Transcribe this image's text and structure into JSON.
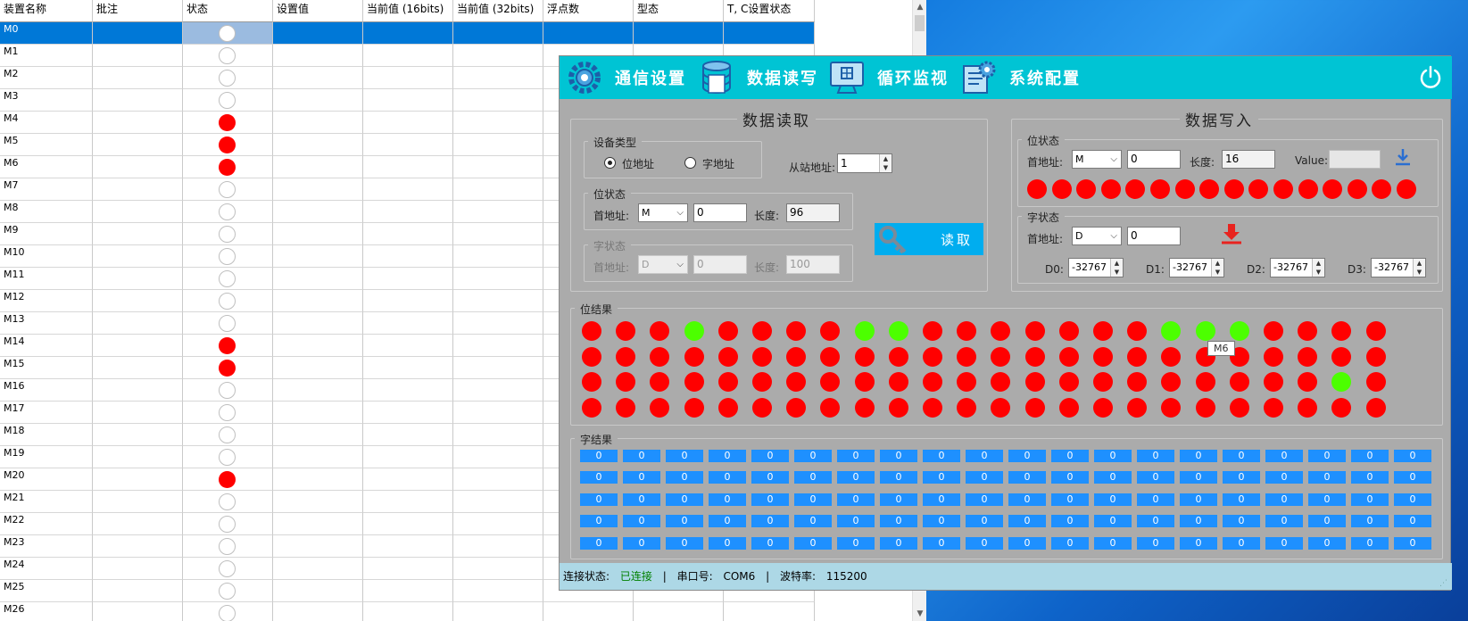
{
  "grid": {
    "headers": [
      "装置名称",
      "批注",
      "状态",
      "设置值",
      "当前值 (16bits)",
      "当前值 (32bits)",
      "浮点数",
      "型态",
      "T, C设置状态"
    ],
    "rows": [
      {
        "name": "M0",
        "on": false,
        "selected": true
      },
      {
        "name": "M1",
        "on": false
      },
      {
        "name": "M2",
        "on": false
      },
      {
        "name": "M3",
        "on": false
      },
      {
        "name": "M4",
        "on": true
      },
      {
        "name": "M5",
        "on": true
      },
      {
        "name": "M6",
        "on": true
      },
      {
        "name": "M7",
        "on": false
      },
      {
        "name": "M8",
        "on": false
      },
      {
        "name": "M9",
        "on": false
      },
      {
        "name": "M10",
        "on": false
      },
      {
        "name": "M11",
        "on": false
      },
      {
        "name": "M12",
        "on": false
      },
      {
        "name": "M13",
        "on": false
      },
      {
        "name": "M14",
        "on": true
      },
      {
        "name": "M15",
        "on": true
      },
      {
        "name": "M16",
        "on": false
      },
      {
        "name": "M17",
        "on": false
      },
      {
        "name": "M18",
        "on": false
      },
      {
        "name": "M19",
        "on": false
      },
      {
        "name": "M20",
        "on": true
      },
      {
        "name": "M21",
        "on": false
      },
      {
        "name": "M22",
        "on": false
      },
      {
        "name": "M23",
        "on": false
      },
      {
        "name": "M24",
        "on": false
      },
      {
        "name": "M25",
        "on": false
      },
      {
        "name": "M26",
        "on": false
      }
    ]
  },
  "nav": {
    "comm": "通信设置",
    "rw": "数据读写",
    "monitor": "循环监视",
    "config": "系统配置"
  },
  "read": {
    "title": "数据读取",
    "device_type_title": "设备类型",
    "bit_addr": "位地址",
    "word_addr": "字地址",
    "slave_label": "从站地址:",
    "slave_value": "1",
    "bit_title": "位状态",
    "first_addr_label": "首地址:",
    "bit_area": "M",
    "bit_start": "0",
    "len_label": "长度:",
    "bit_len": "96",
    "word_title": "字状态",
    "word_area": "D",
    "word_start": "0",
    "word_len": "100",
    "read_button": "读取"
  },
  "write": {
    "title": "数据写入",
    "bit_title": "位状态",
    "first_addr_label": "首地址:",
    "bit_area": "M",
    "bit_start": "0",
    "len_label": "长度:",
    "bit_len": "16",
    "value_label": "Value:",
    "value": "",
    "bit_states": [
      true,
      true,
      true,
      true,
      true,
      true,
      true,
      true,
      true,
      true,
      true,
      true,
      true,
      true,
      true,
      true
    ],
    "word_title": "字状态",
    "word_area": "D",
    "word_start": "0",
    "d_labels": [
      "D0:",
      "D1:",
      "D2:",
      "D3:"
    ],
    "d_values": [
      "-32767",
      "-32767",
      "-32767",
      "-32767"
    ]
  },
  "bit_result": {
    "title": "位结果",
    "rows": [
      [
        0,
        0,
        0,
        1,
        0,
        0,
        0,
        0,
        1,
        1,
        0,
        0,
        0,
        0,
        0,
        0,
        0,
        1,
        1,
        1,
        0,
        0,
        0,
        0
      ],
      [
        0,
        0,
        0,
        0,
        0,
        0,
        0,
        0,
        0,
        0,
        0,
        0,
        0,
        0,
        0,
        0,
        0,
        0,
        0,
        0,
        0,
        0,
        0,
        0
      ],
      [
        0,
        0,
        0,
        0,
        0,
        0,
        0,
        0,
        0,
        0,
        0,
        0,
        0,
        0,
        0,
        0,
        0,
        0,
        0,
        0,
        0,
        0,
        1,
        0
      ],
      [
        0,
        0,
        0,
        0,
        0,
        0,
        0,
        0,
        0,
        0,
        0,
        0,
        0,
        0,
        0,
        0,
        0,
        0,
        0,
        0,
        0,
        0,
        0,
        0
      ]
    ],
    "tooltip": "M6"
  },
  "word_result": {
    "title": "字结果",
    "rows": 5,
    "cols": 20,
    "value": "0"
  },
  "status": {
    "conn_label": "连接状态:",
    "conn_value": "已连接",
    "sep": "|",
    "port_label": "串口号:",
    "port_value": "COM6",
    "baud_label": "波特率:",
    "baud_value": "115200",
    "conn_color": "#008000"
  },
  "colors": {
    "on": "#ff0000",
    "green": "#4cff00",
    "nav": "#00c4d4",
    "cell": "#1e90ff",
    "accent": "#00adef"
  }
}
